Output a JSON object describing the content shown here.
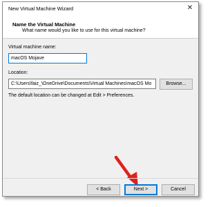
{
  "window": {
    "title": "New Virtual Machine Wizard",
    "close_glyph": "✕"
  },
  "header": {
    "title": "Name the Virtual Machine",
    "subtitle": "What name would you like to use for this virtual machine?"
  },
  "vm_name": {
    "label": "Virtual machine name:",
    "value": "macOS Mojave"
  },
  "location": {
    "label": "Location:",
    "value": "C:\\Users\\faiz_\\OneDrive\\Documents\\Virtual Machines\\macOS Mo",
    "browse_label": "Browse...",
    "hint": "The default location can be changed at Edit > Preferences."
  },
  "buttons": {
    "back_label": "< Back",
    "next_label": "Next >",
    "cancel_label": "Cancel"
  },
  "colors": {
    "focus_blue": "#0078d7",
    "arrow_red": "#e0201b"
  }
}
